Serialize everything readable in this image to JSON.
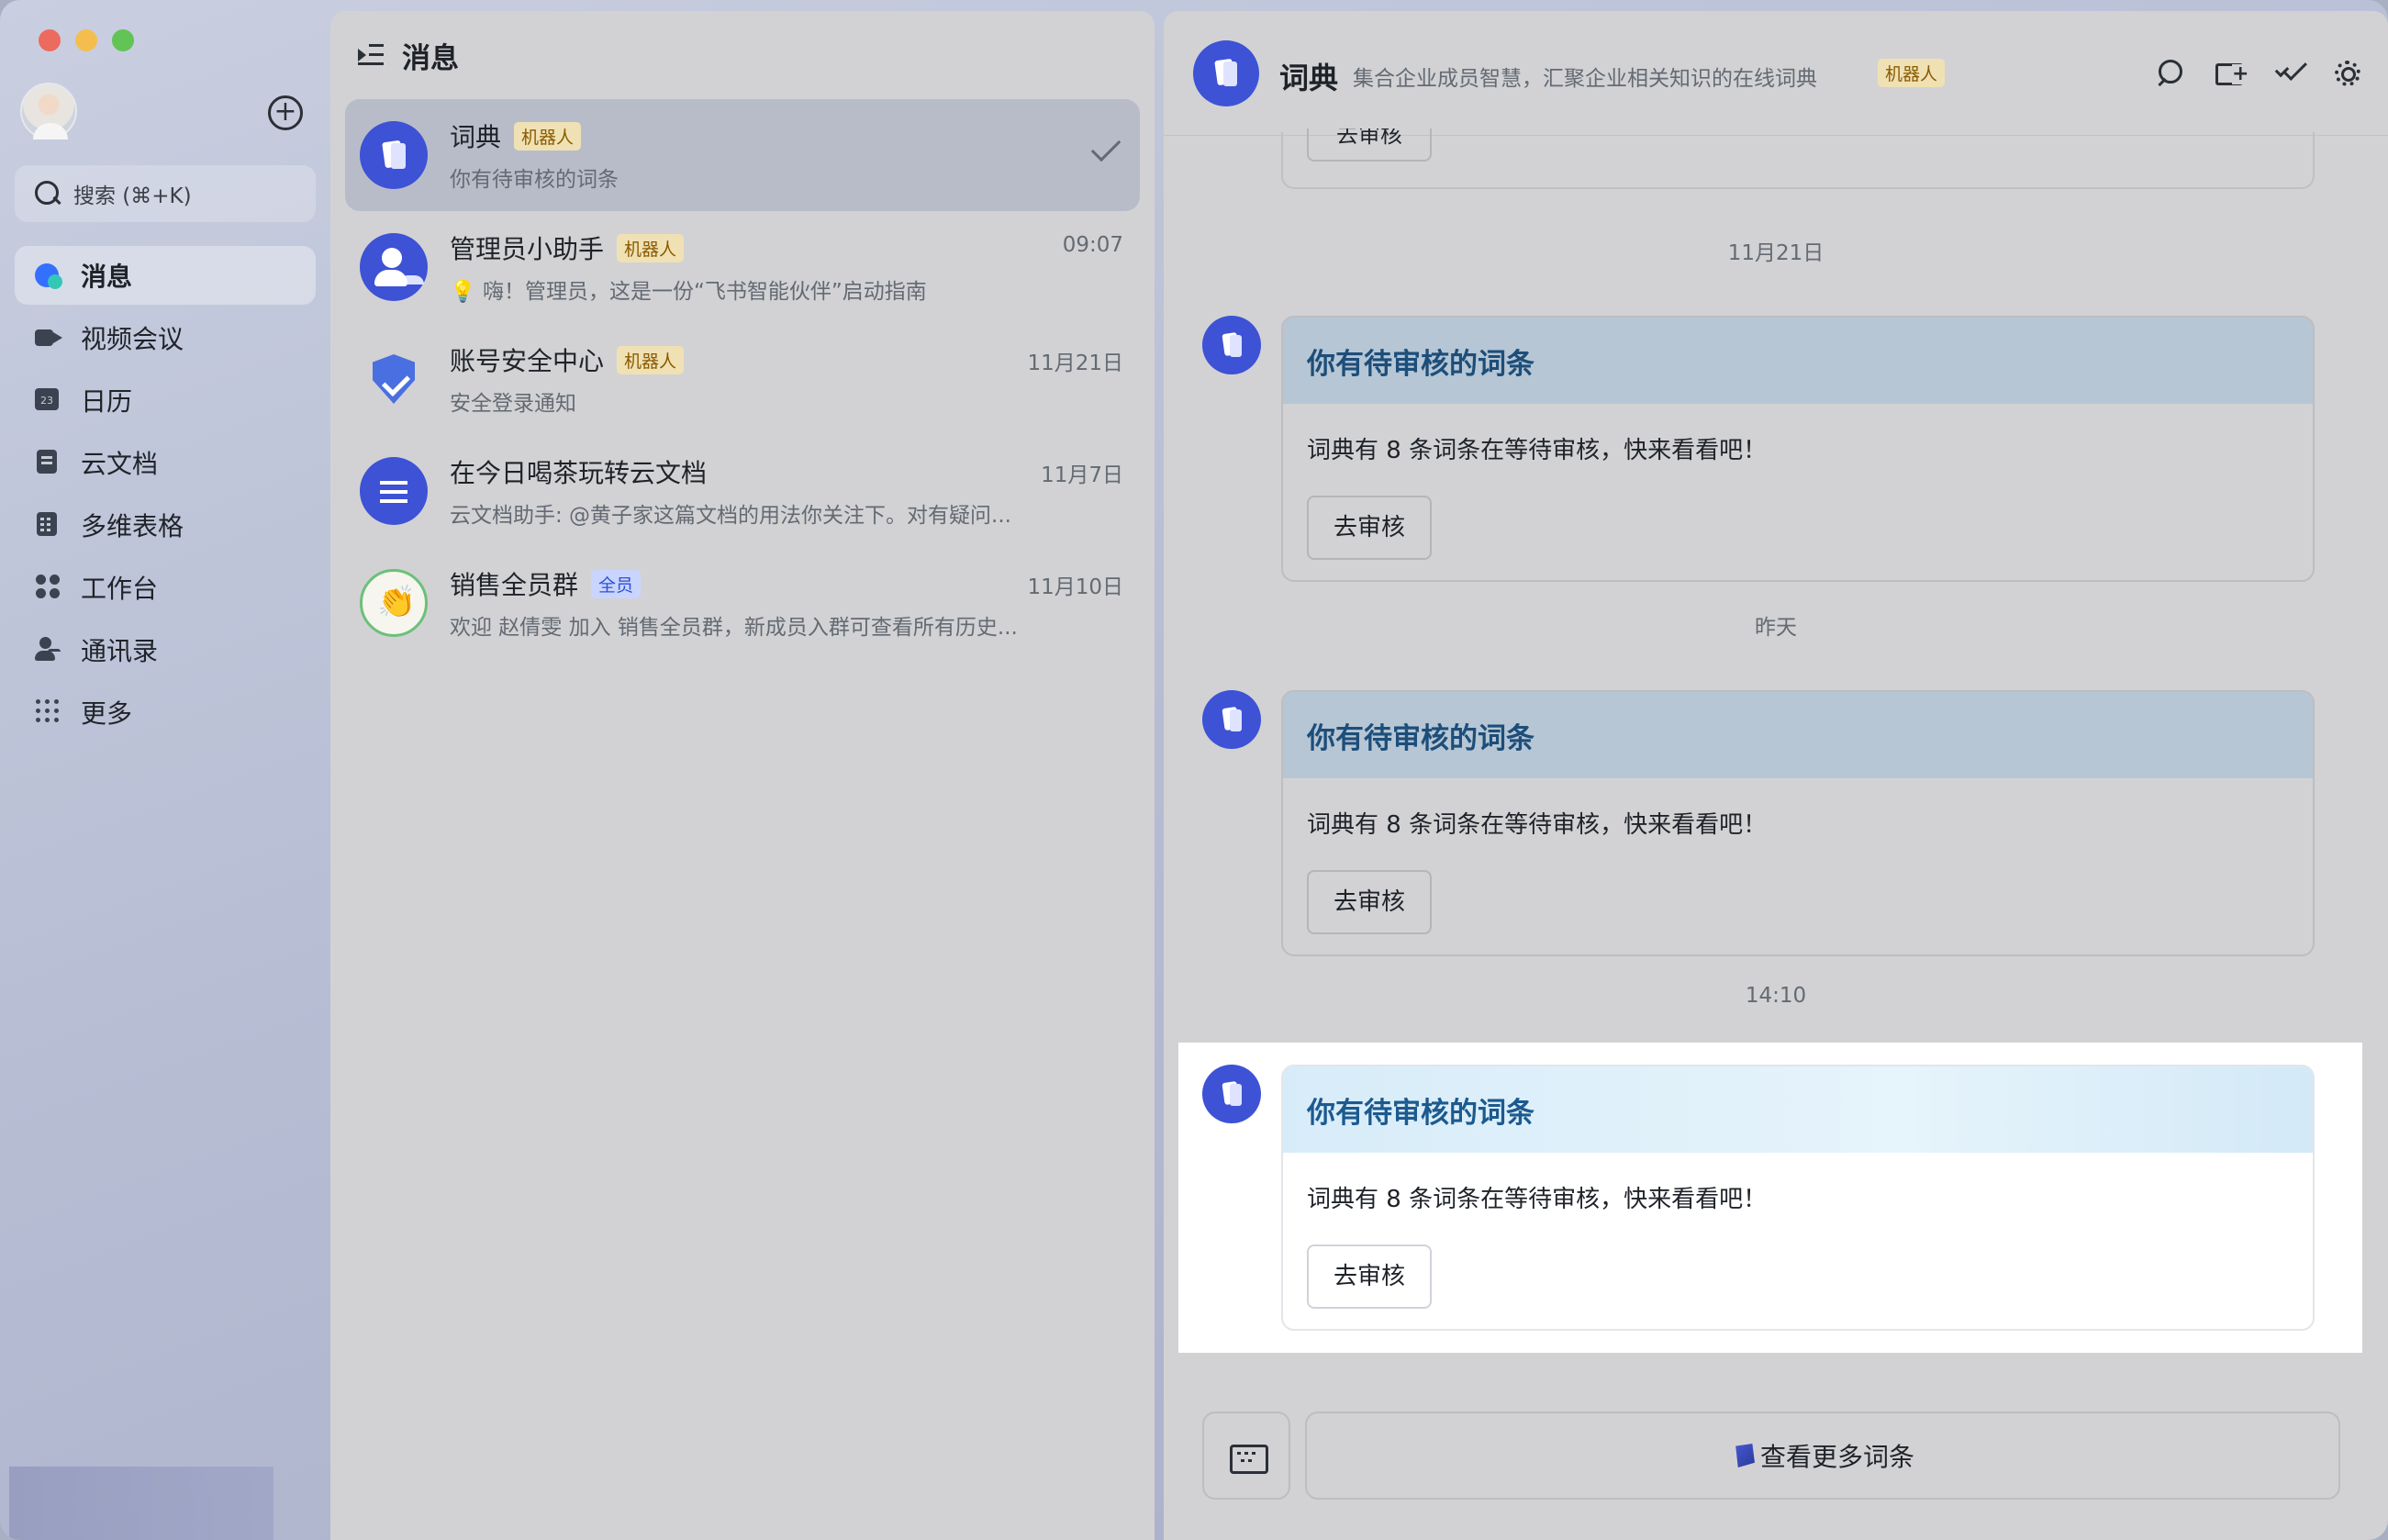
{
  "sidebar": {
    "search_placeholder": "搜索 (⌘+K)",
    "nav": [
      {
        "label": "消息",
        "icon": "message-icon",
        "active": true
      },
      {
        "label": "视频会议",
        "icon": "video-icon"
      },
      {
        "label": "日历",
        "icon": "calendar-icon"
      },
      {
        "label": "云文档",
        "icon": "doc-icon"
      },
      {
        "label": "多维表格",
        "icon": "table-icon"
      },
      {
        "label": "工作台",
        "icon": "workspace-icon"
      },
      {
        "label": "通讯录",
        "icon": "contacts-icon"
      },
      {
        "label": "更多",
        "icon": "more-icon"
      }
    ]
  },
  "conversations": {
    "title": "消息",
    "items": [
      {
        "name": "词典",
        "tag": "机器人",
        "preview": "你有待审核的词条",
        "time": "",
        "active": true
      },
      {
        "name": "管理员小助手",
        "tag": "机器人",
        "preview": "💡 嗨！管理员，这是一份“飞书智能伙伴”启动指南",
        "time": "09:07"
      },
      {
        "name": "账号安全中心",
        "tag": "机器人",
        "preview": "安全登录通知",
        "time": "11月21日"
      },
      {
        "name": "在今日喝茶玩转云文档",
        "tag": "",
        "preview": "云文档助手: @黄子家这篇文档的用法你关注下。对有疑问...",
        "time": "11月7日"
      },
      {
        "name": "销售全员群",
        "tag": "全员",
        "preview": "欢迎 赵倩雯 加入 销售全员群，新成员入群可查看所有历史...",
        "time": "11月10日"
      }
    ]
  },
  "chat": {
    "title": "词典",
    "description": "集合企业成员智慧，汇聚企业相关知识的在线词典",
    "tag": "机器人",
    "stub_button": "去审核",
    "separators": [
      "11月21日",
      "昨天",
      "14:10"
    ],
    "messages": [
      {
        "title": "你有待审核的词条",
        "text": "词典有 8 条词条在等待审核，快来看看吧！",
        "button": "去审核"
      },
      {
        "title": "你有待审核的词条",
        "text": "词典有 8 条词条在等待审核，快来看看吧！",
        "button": "去审核"
      },
      {
        "title": "你有待审核的词条",
        "text": "词典有 8 条词条在等待审核，快来看看吧！",
        "button": "去审核"
      }
    ],
    "footer_button": "查看更多词条"
  }
}
